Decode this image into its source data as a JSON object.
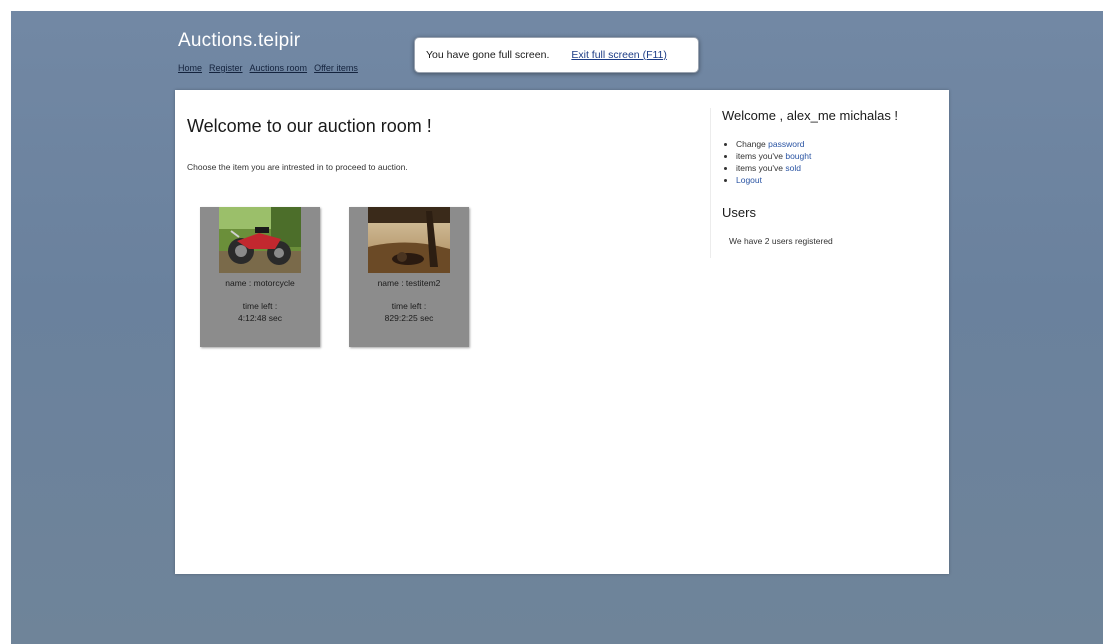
{
  "site": {
    "title": "Auctions.teipir"
  },
  "nav": [
    "Home",
    "Register",
    "Auctions room",
    "Offer items"
  ],
  "fullscreen": {
    "message": "You have gone full screen.",
    "exit_label": "Exit full screen (F11)"
  },
  "main": {
    "title": "Welcome to our auction room !",
    "intro": "Choose the item you are intrested in to proceed to auction.",
    "items": [
      {
        "name": "name : motorcycle",
        "time_label": "time left :",
        "time_value": "4:12:48 sec"
      },
      {
        "name": "name : testitem2",
        "time_label": "time left :",
        "time_value": "829:2:25 sec"
      }
    ]
  },
  "sidebar": {
    "welcome": "Welcome , alex_me michalas !",
    "menu": [
      {
        "prefix": "Change ",
        "link": "password"
      },
      {
        "prefix": "items you've ",
        "link": "bought"
      },
      {
        "prefix": "items you've ",
        "link": "sold"
      },
      {
        "prefix": "",
        "link": "Logout"
      }
    ],
    "users_title": "Users",
    "users_text": "We have 2 users registered"
  }
}
